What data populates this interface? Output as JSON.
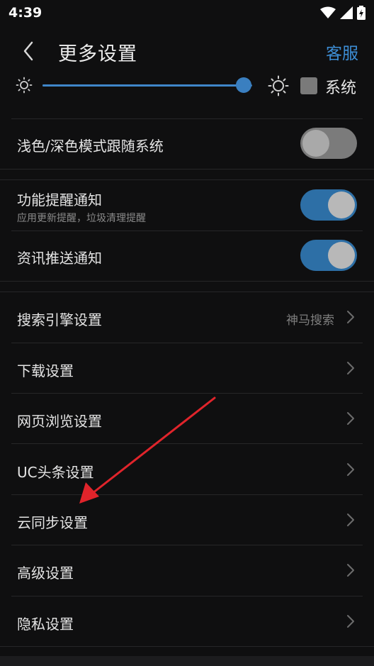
{
  "status_bar": {
    "time": "4:39"
  },
  "header": {
    "title": "更多设置",
    "service_label": "客服"
  },
  "brightness": {
    "level_fraction": 0.96,
    "system_label": "系统"
  },
  "settings": {
    "theme_follow_label": "浅色/深色模式跟随系统",
    "theme_follow_on": false,
    "feature_notify_label": "功能提醒通知",
    "feature_notify_sub": "应用更新提醒，垃圾清理提醒",
    "feature_notify_on": true,
    "news_push_label": "资讯推送通知",
    "news_push_on": true
  },
  "menu": [
    {
      "label": "搜索引擎设置",
      "value": "神马搜索"
    },
    {
      "label": "下载设置",
      "value": ""
    },
    {
      "label": "网页浏览设置",
      "value": ""
    },
    {
      "label": "UC头条设置",
      "value": ""
    },
    {
      "label": "云同步设置",
      "value": ""
    },
    {
      "label": "高级设置",
      "value": ""
    },
    {
      "label": "隐私设置",
      "value": ""
    }
  ],
  "colors": {
    "accent": "#3d8ed6",
    "annotation_arrow": "#e0242b",
    "background": "#0f0f10"
  }
}
